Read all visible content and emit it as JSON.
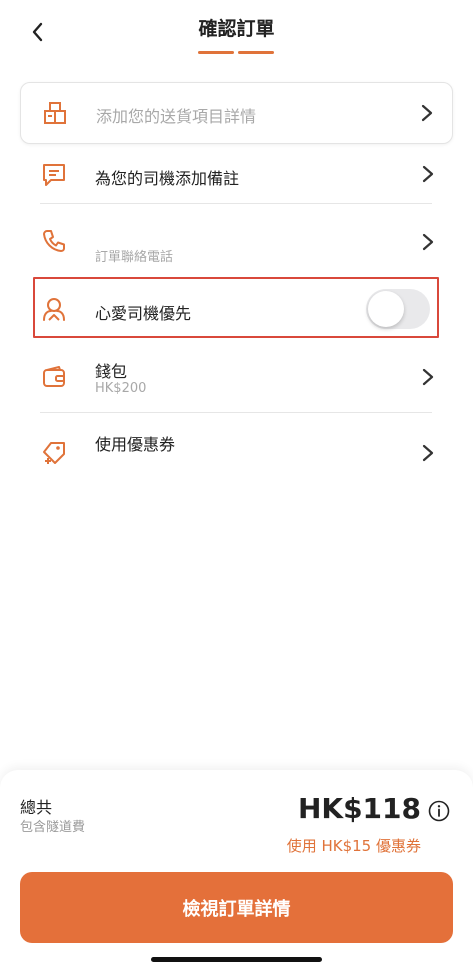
{
  "header": {
    "title": "確認訂單",
    "back_icon": "back-chevron-icon"
  },
  "items": {
    "delivery_details": {
      "label": "添加您的送貨項目詳情",
      "icon": "box-icon"
    },
    "driver_note": {
      "label": "為您的司機添加備註",
      "icon": "note-icon"
    },
    "contact_phone": {
      "sub": "訂單聯絡電話",
      "icon": "phone-icon"
    },
    "favorite_driver": {
      "label": "心愛司機優先",
      "icon": "driver-icon",
      "toggle_on": false
    },
    "wallet": {
      "label": "錢包",
      "sub": "HK$200",
      "icon": "wallet-icon"
    },
    "coupon": {
      "label": "使用優惠券",
      "icon": "coupon-icon"
    }
  },
  "summary": {
    "total_label": "總共",
    "tunnel_note": "包含隧道費",
    "price": "HK$118",
    "coupon_note": "使用 HK$15 優惠券"
  },
  "cta": {
    "label": "檢視訂單詳情"
  },
  "colors": {
    "accent": "#e0733a",
    "highlight_border": "#d9483b",
    "button": "#e4703a"
  }
}
